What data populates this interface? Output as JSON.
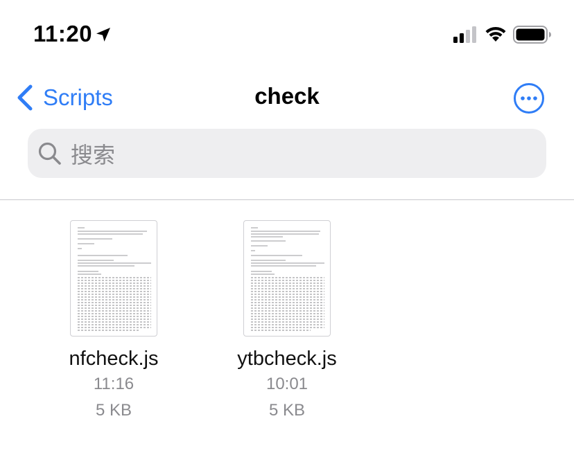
{
  "status_bar": {
    "time": "11:20",
    "icons": [
      "location-arrow-icon",
      "cellular-signal-icon",
      "wifi-icon",
      "battery-icon"
    ]
  },
  "nav": {
    "back_label": "Scripts",
    "title": "check",
    "accent_color": "#2f7df6"
  },
  "search": {
    "placeholder": "搜索"
  },
  "files": [
    {
      "name": "nfcheck.js",
      "time": "11:16",
      "size": "5 KB"
    },
    {
      "name": "ytbcheck.js",
      "time": "10:01",
      "size": "5 KB"
    }
  ]
}
